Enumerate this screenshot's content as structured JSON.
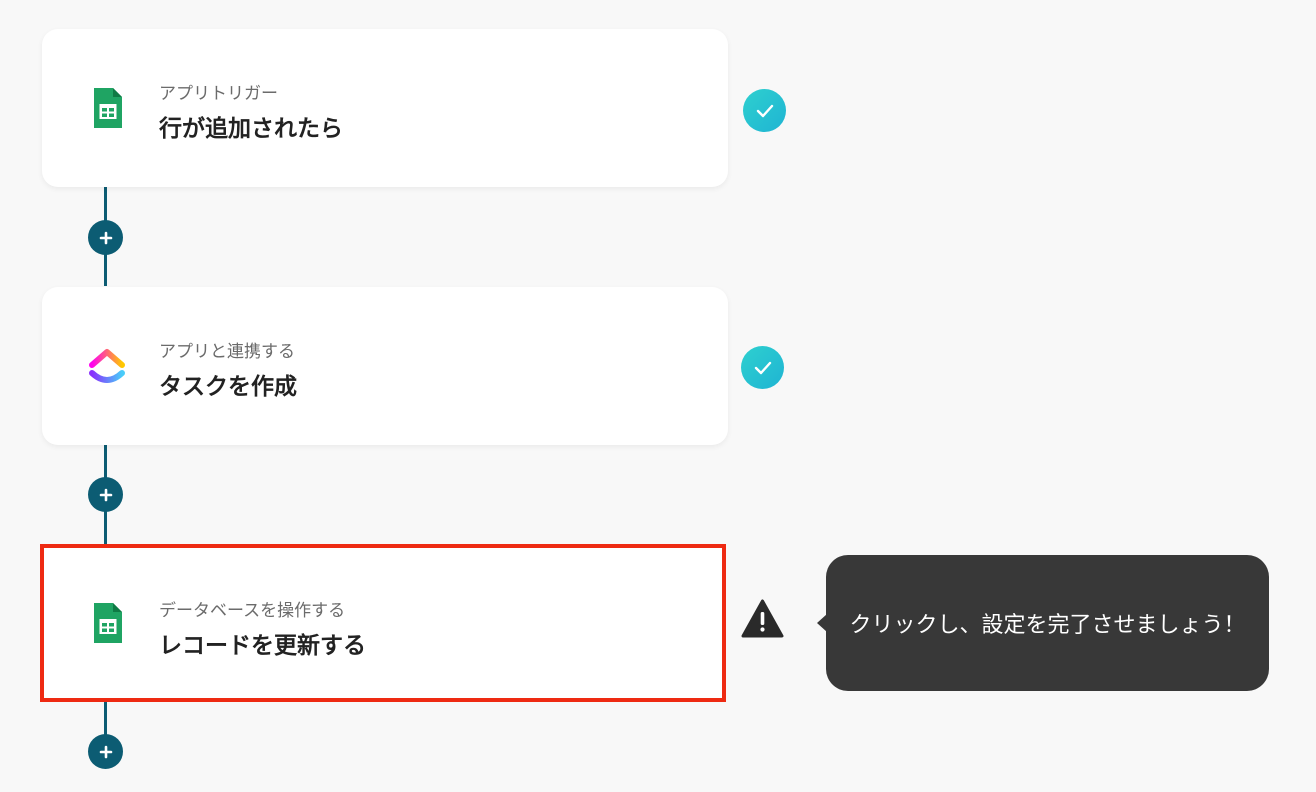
{
  "steps": [
    {
      "type_label": "アプリトリガー",
      "title": "行が追加されたら",
      "app_icon": "google-sheets-icon",
      "status": "complete"
    },
    {
      "type_label": "アプリと連携する",
      "title": "タスクを作成",
      "app_icon": "clickup-icon",
      "status": "complete"
    },
    {
      "type_label": "データベースを操作する",
      "title": "レコードを更新する",
      "app_icon": "google-sheets-icon",
      "status": "warning"
    }
  ],
  "tooltip": {
    "text": "クリックし、設定を完了させましょう！"
  },
  "colors": {
    "connector": "#0c5c73",
    "check_gradient_start": "#2ed0cf",
    "check_gradient_end": "#1fb4d3",
    "highlight_border": "#ee2a12",
    "tooltip_bg": "#383838",
    "sheets_green": "#1fa463"
  },
  "icons": {
    "add_step": "plus-icon",
    "complete": "check-icon",
    "warning": "warning-triangle-icon"
  }
}
